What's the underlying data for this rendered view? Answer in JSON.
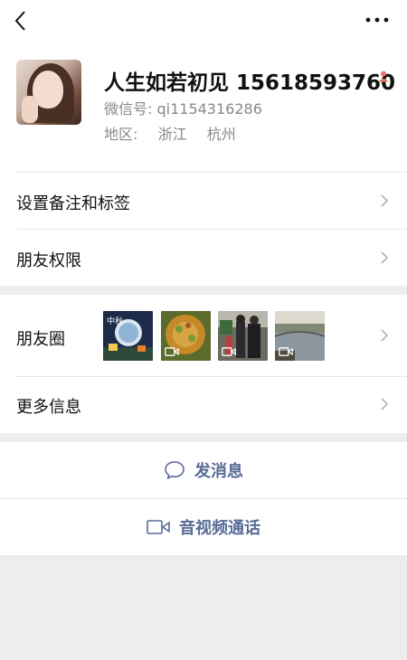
{
  "topbar": {
    "back_icon": "chevron-left-icon",
    "more_icon": "ellipsis-icon"
  },
  "profile": {
    "name": "人生如若初见 15618593760",
    "wechat_id": "微信号:  qi1154316286",
    "region_label": "地区:",
    "region_province": "浙江",
    "region_city": "杭州",
    "gender_icon": "female-person-icon",
    "gender_color": "#e87a6e"
  },
  "rows": {
    "remark_tags": "设置备注和标签",
    "friend_permissions": "朋友权限",
    "moments": "朋友圈",
    "more_info": "更多信息"
  },
  "moments_thumbs": [
    {
      "name": "moon-festival-thumb",
      "video": false
    },
    {
      "name": "food-thumb",
      "video": true
    },
    {
      "name": "street-thumb",
      "video": true
    },
    {
      "name": "river-bridge-thumb",
      "video": true
    }
  ],
  "actions": {
    "message": "发消息",
    "call": "音视频通话"
  },
  "colors": {
    "link": "#576b95",
    "background": "#ededed"
  }
}
